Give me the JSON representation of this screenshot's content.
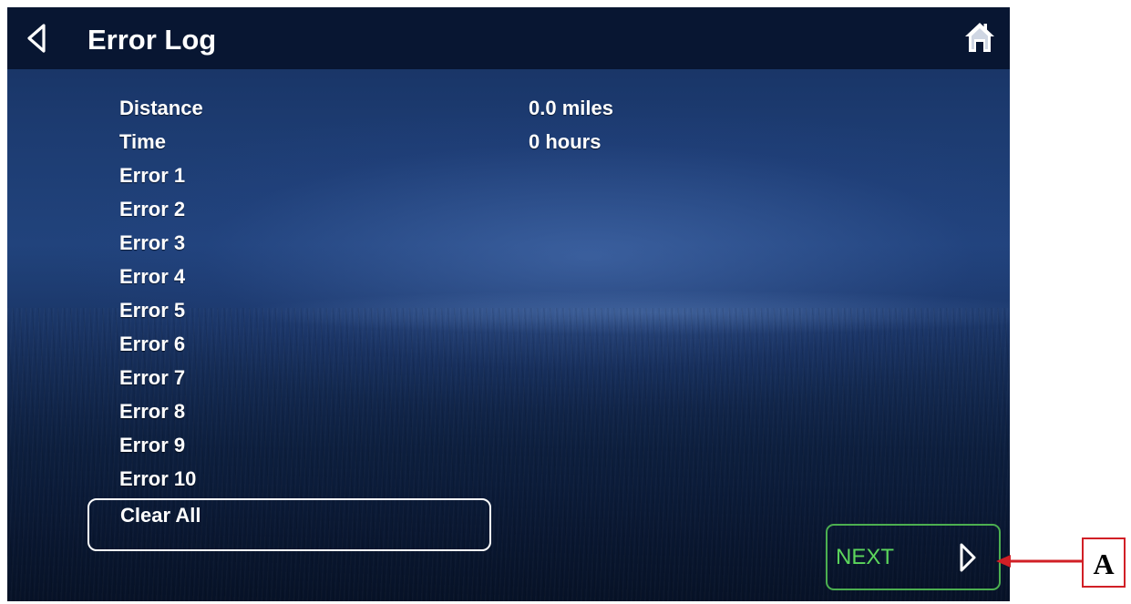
{
  "header": {
    "title": "Error Log",
    "back_icon": "chevron-left-outline-icon",
    "home_icon": "home-icon"
  },
  "rows": [
    {
      "label": "Distance",
      "value": "0.0 miles"
    },
    {
      "label": "Time",
      "value": "0 hours"
    },
    {
      "label": "Error 1",
      "value": ""
    },
    {
      "label": "Error 2",
      "value": ""
    },
    {
      "label": "Error 3",
      "value": ""
    },
    {
      "label": "Error 4",
      "value": ""
    },
    {
      "label": "Error 5",
      "value": ""
    },
    {
      "label": "Error 6",
      "value": ""
    },
    {
      "label": "Error 7",
      "value": ""
    },
    {
      "label": "Error 8",
      "value": ""
    },
    {
      "label": "Error 9",
      "value": ""
    },
    {
      "label": "Error 10",
      "value": ""
    }
  ],
  "actions": {
    "clear_all_label": "Clear All",
    "next_label": "NEXT",
    "next_icon": "chevron-right-outline-icon"
  },
  "callout": {
    "letter": "A",
    "color": "#d11f26"
  },
  "colors": {
    "topbar": "#081632",
    "text": "#ffffff",
    "next_border": "#4caf50",
    "next_text": "#5cd65c"
  }
}
